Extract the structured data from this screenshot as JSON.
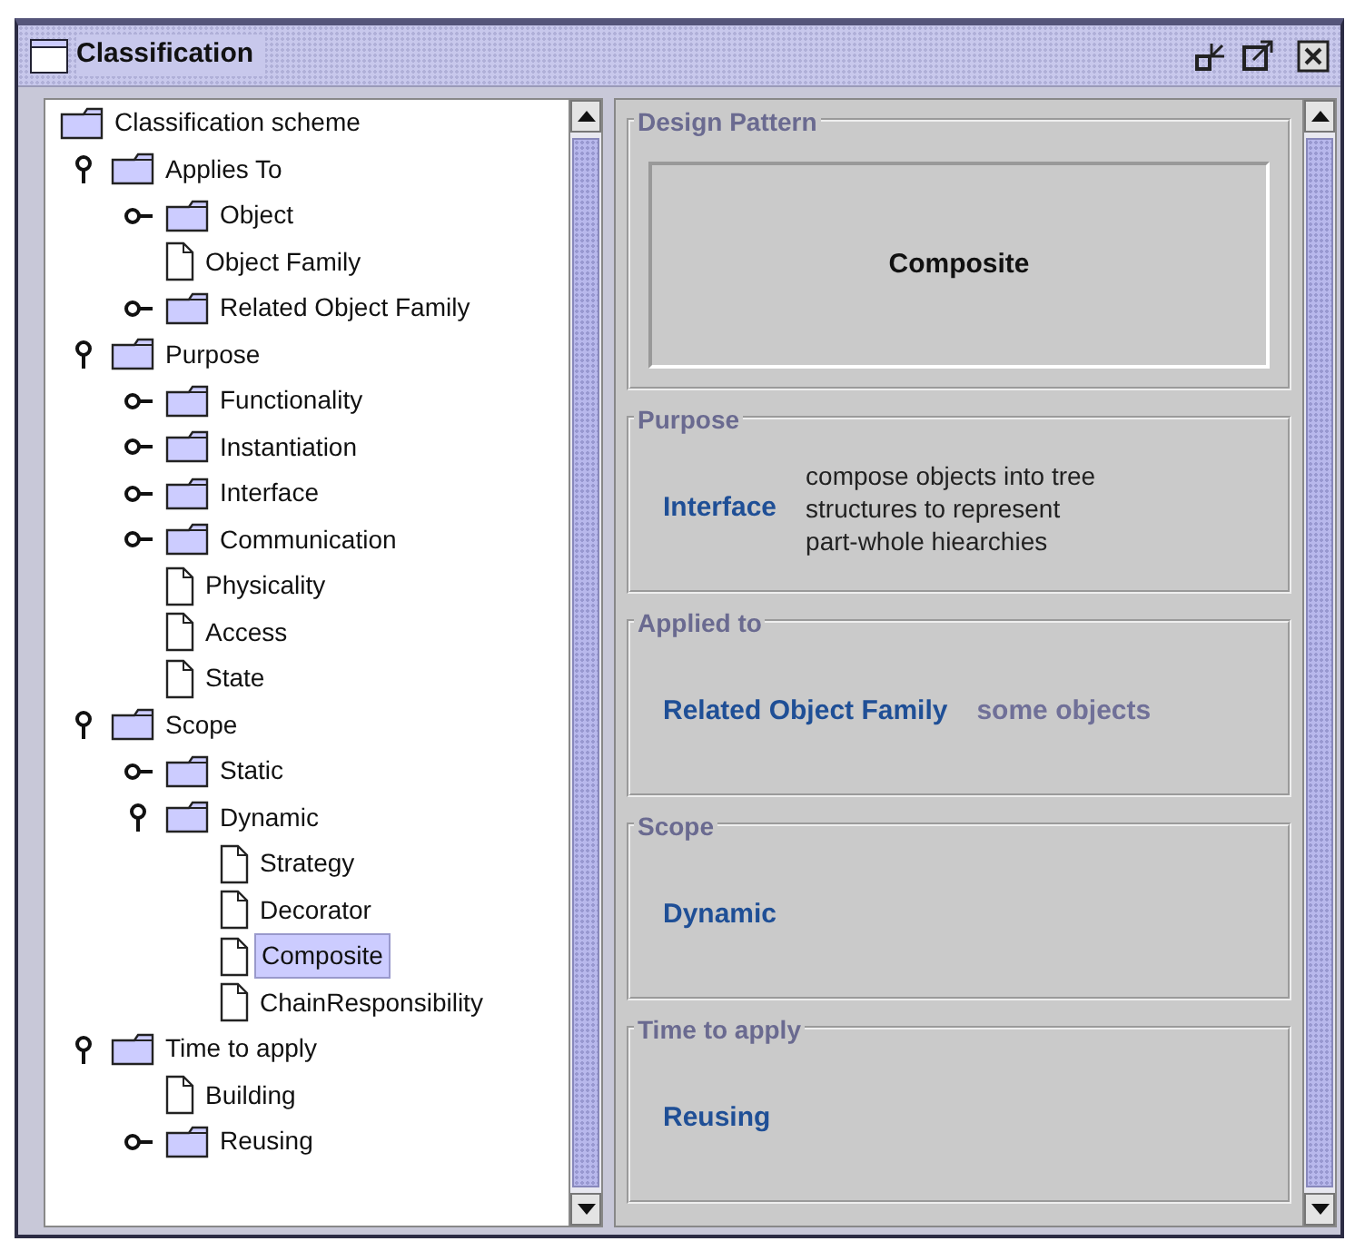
{
  "window": {
    "title": "Classification"
  },
  "tree": {
    "label": "Classification scheme",
    "kind": "folder",
    "selected": false,
    "children": [
      {
        "label": "Applies To",
        "kind": "folder",
        "expanded": true,
        "selected": false,
        "children": [
          {
            "label": "Object",
            "kind": "folder",
            "expanded": false,
            "selected": false
          },
          {
            "label": "Object Family",
            "kind": "leaf",
            "selected": false
          },
          {
            "label": "Related Object Family",
            "kind": "folder",
            "expanded": false,
            "selected": false
          }
        ]
      },
      {
        "label": "Purpose",
        "kind": "folder",
        "expanded": true,
        "selected": false,
        "children": [
          {
            "label": "Functionality",
            "kind": "folder",
            "expanded": false,
            "selected": false
          },
          {
            "label": "Instantiation",
            "kind": "folder",
            "expanded": false,
            "selected": false
          },
          {
            "label": "Interface",
            "kind": "folder",
            "expanded": false,
            "selected": false
          },
          {
            "label": "Communication",
            "kind": "folder",
            "expanded": false,
            "selected": false
          },
          {
            "label": "Physicality",
            "kind": "leaf",
            "selected": false
          },
          {
            "label": "Access",
            "kind": "leaf",
            "selected": false
          },
          {
            "label": "State",
            "kind": "leaf",
            "selected": false
          }
        ]
      },
      {
        "label": "Scope",
        "kind": "folder",
        "expanded": true,
        "selected": false,
        "children": [
          {
            "label": "Static",
            "kind": "folder",
            "expanded": false,
            "selected": false
          },
          {
            "label": "Dynamic",
            "kind": "folder",
            "expanded": true,
            "selected": false,
            "children": [
              {
                "label": "Strategy",
                "kind": "leaf",
                "selected": false
              },
              {
                "label": "Decorator",
                "kind": "leaf",
                "selected": false
              },
              {
                "label": "Composite",
                "kind": "leaf",
                "selected": true
              },
              {
                "label": "ChainResponsibility",
                "kind": "leaf",
                "selected": false
              }
            ]
          }
        ]
      },
      {
        "label": "Time to apply",
        "kind": "folder",
        "expanded": true,
        "selected": false,
        "children": [
          {
            "label": "Building",
            "kind": "leaf",
            "selected": false
          },
          {
            "label": "Reusing",
            "kind": "folder",
            "expanded": false,
            "selected": false
          }
        ]
      }
    ]
  },
  "details": {
    "design_pattern": {
      "title": "Design Pattern",
      "value": "Composite"
    },
    "groups": [
      {
        "title": "Purpose",
        "value": "Interface",
        "description_lines": [
          "compose objects into tree",
          "structures to represent",
          "part-whole hiearchies"
        ]
      },
      {
        "title": "Applied to",
        "value": "Related Object Family",
        "note": "some objects"
      },
      {
        "title": "Scope",
        "value": "Dynamic"
      },
      {
        "title": "Time to apply",
        "value": "Reusing"
      }
    ]
  }
}
